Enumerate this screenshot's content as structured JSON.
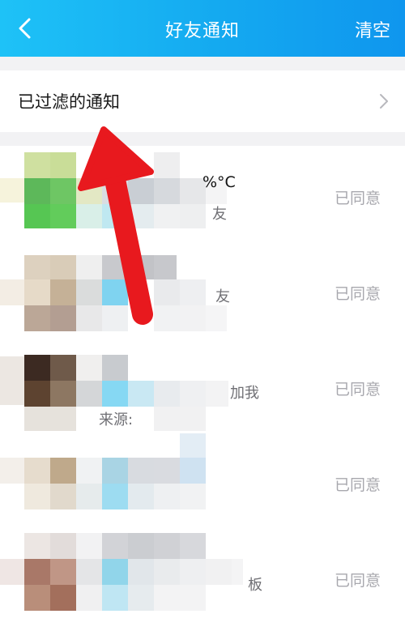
{
  "header": {
    "title": "好友通知",
    "clear_label": "清空"
  },
  "filter": {
    "label": "已过滤的通知"
  },
  "requests": [
    {
      "fragment": "%°C",
      "fragment2": "友",
      "status": "已同意"
    },
    {
      "fragment": "友",
      "status": "已同意"
    },
    {
      "fragment": "加我",
      "fragment2": "来源:",
      "status": "已同意"
    },
    {
      "status": "已同意"
    },
    {
      "fragment": "板",
      "status": "已同意"
    }
  ],
  "colors": {
    "header_start": "#1ec2f7",
    "header_end": "#0f96ee",
    "arrow": "#e8191e",
    "status_text": "#a8a8ae"
  }
}
